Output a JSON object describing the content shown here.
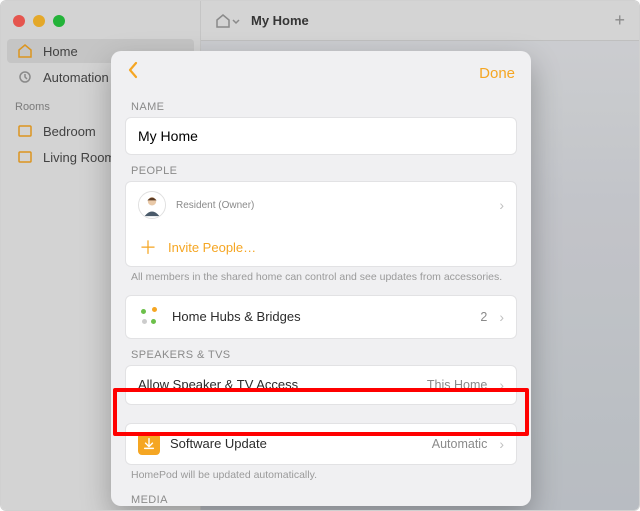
{
  "sidebar": {
    "items": [
      {
        "label": "Home"
      },
      {
        "label": "Automation"
      }
    ],
    "rooms_header": "Rooms",
    "rooms": [
      {
        "label": "Bedroom"
      },
      {
        "label": "Living Room"
      }
    ]
  },
  "header": {
    "title": "My Home"
  },
  "sheet": {
    "done": "Done",
    "name_section": "NAME",
    "name_value": "My Home",
    "people_section": "PEOPLE",
    "resident_sub": "Resident (Owner)",
    "invite_label": "Invite People…",
    "people_footnote": "All members in the shared home can control and see updates from accessories.",
    "hubs_label": "Home Hubs & Bridges",
    "hubs_count": "2",
    "speakers_section": "SPEAKERS & TVS",
    "speaker_access_label": "Allow Speaker & TV Access",
    "speaker_access_value": "This Home",
    "software_update_label": "Software Update",
    "software_update_value": "Automatic",
    "software_footnote": "HomePod will be updated automatically.",
    "media_section": "MEDIA"
  }
}
